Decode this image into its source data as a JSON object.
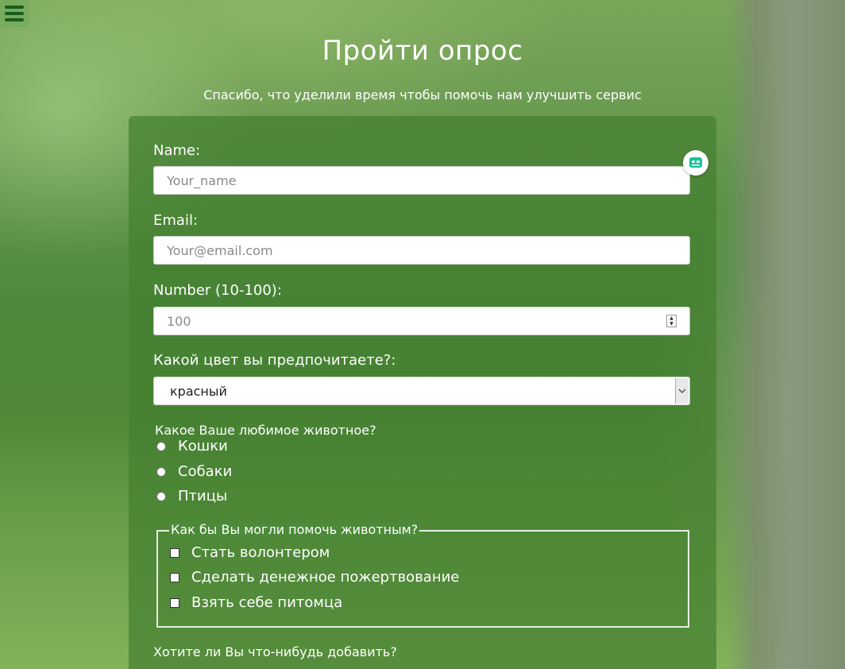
{
  "header": {
    "menu_icon": "hamburger-menu-icon",
    "title": "Пройти опрос",
    "subtitle": "Спасибо, что уделили время чтобы помочь нам улучшить сервис"
  },
  "form": {
    "name": {
      "label": "Name:",
      "placeholder": "Your_name",
      "value": ""
    },
    "email": {
      "label": "Email:",
      "placeholder": "Your@email.com",
      "value": ""
    },
    "number": {
      "label": "Number (10-100):",
      "placeholder": "100",
      "value": ""
    },
    "color": {
      "label": "Какой цвет вы предпочитаете?:",
      "selected": "красный"
    },
    "animal": {
      "question": "Какое Ваше любимое животное?",
      "options": [
        "Кошки",
        "Собаки",
        "Птицы"
      ]
    },
    "help": {
      "legend": "Как бы Вы могли помочь животным?",
      "options": [
        "Стать волонтером",
        "Сделать денежное пожертвование",
        "Взять себе питомца"
      ]
    },
    "comment": {
      "label": "Хотите ли Вы что-нибудь добавить?"
    }
  },
  "extension": {
    "icon": "assistant-bot-icon",
    "accent": "#15c39a"
  },
  "colors": {
    "panel": "#448030",
    "menu_icon": "#1a5c1a"
  }
}
